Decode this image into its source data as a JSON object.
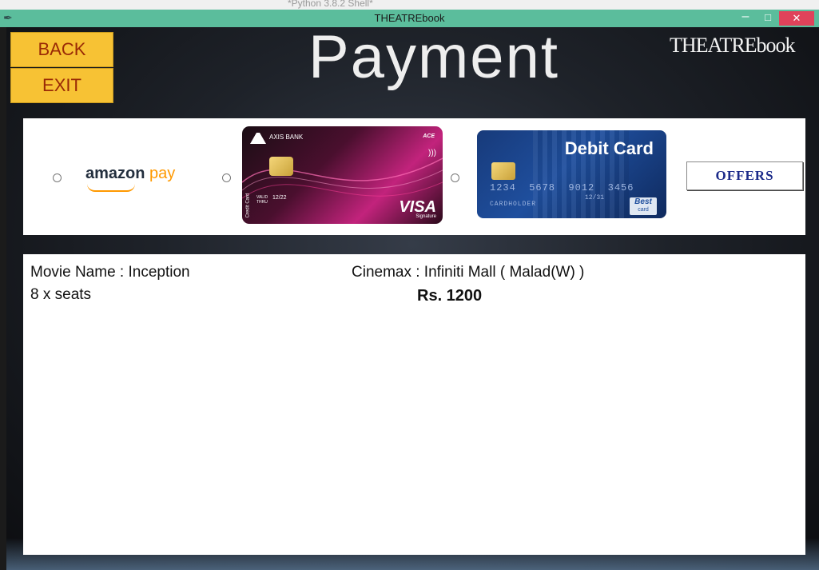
{
  "window": {
    "title": "THEATREbook",
    "icon": "feather-icon",
    "behind_title": "*Python 3.8.2 Shell*",
    "colors": {
      "titlebar": "#5bbd9c",
      "close": "#e0425a"
    }
  },
  "nav": {
    "back_label": "BACK",
    "exit_label": "EXIT"
  },
  "header": {
    "title": "Payment",
    "brand": "THEATREbook"
  },
  "payment_options": [
    {
      "id": "amazon-pay",
      "text_a": "amazon",
      "text_b": "pay"
    },
    {
      "id": "axis-card",
      "bank": "AXIS BANK",
      "variant": "ACE",
      "network": "VISA",
      "tier": "Signature",
      "type_label": "Credit Card",
      "valid_label": "VALID THRU",
      "valid": "12/22"
    },
    {
      "id": "debit-card",
      "title": "Debit Card",
      "number": "1234  5678  9012  3456",
      "holder": "CARDHOLDER",
      "expiry": "12/31",
      "badge_top": "Best",
      "badge_bottom": "card"
    }
  ],
  "offers_label": "OFFERS",
  "booking": {
    "movie": "Movie Name : Inception",
    "cinema": "Cinemax : Infiniti Mall ( Malad(W) )",
    "seats": "8 x seats",
    "price": "Rs. 1200"
  },
  "colors": {
    "accent_yellow": "#f7c234",
    "button_text": "#9a2a06",
    "offers_text": "#1c2b8a"
  }
}
